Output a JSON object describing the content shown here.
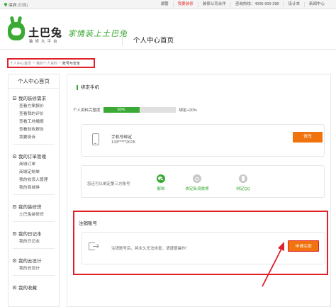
{
  "topbar": {
    "city": "深圳",
    "switch": "[切换]",
    "nav": [
      "湖蕾",
      "我要装修",
      "装修公司合作",
      "咨询热线：4006-900-288",
      "设计本",
      "新闻中心"
    ]
  },
  "header": {
    "logo_title": "土巴兔",
    "logo_sub": "装修大平台",
    "slogan": "家情装上土巴兔",
    "page_title": "个人中心首页"
  },
  "breadcrumb": {
    "items": [
      "个人中心首页",
      "我的个人资料",
      "账号与安全"
    ]
  },
  "sidebar": {
    "home": "个人中心首页",
    "groups": [
      {
        "title": "我的装修需求",
        "items": [
          "查看方案报价",
          "查看我的评价",
          "查看工地播报",
          "查看验收报告",
          "我要投诉"
        ]
      },
      {
        "title": "我的订单管理",
        "items": [
          "商城订单",
          "商城定制单",
          "我的收货人管理",
          "我的商城券"
        ]
      },
      {
        "title": "我的装修贷",
        "items": [
          "土巴兔装修贷"
        ]
      },
      {
        "title": "我的日记本",
        "items": [
          "我的日记本"
        ]
      },
      {
        "title": "我的云设计",
        "items": [
          "我的云设计"
        ]
      },
      {
        "title": "我的收藏",
        "items": []
      }
    ]
  },
  "main": {
    "section_title": "绑定手机",
    "progress_label": "个人资料完整度",
    "progress_value": 0.5,
    "progress_text": "50%",
    "progress_hint": "绑定+20%",
    "phone_label": "手机号绑定",
    "phone_number": "133*****2015",
    "modify_button": "修改",
    "bind_text": "您还可以绑定第三方账号",
    "socials": [
      "已绑定微信",
      "绑定新浪微博",
      "绑定QQ"
    ],
    "social_labels": [
      "解绑",
      "绑定新浪微博",
      "绑定QQ"
    ]
  },
  "cancel": {
    "title": "注销账号",
    "text": "注销账号后，将永久无法恢复，请谨慎操作！",
    "apply_button": "申请注销"
  },
  "colors": {
    "brand_green": "#3aaa35",
    "orange": "#f0730e",
    "annotation_red": "#e0202a"
  }
}
